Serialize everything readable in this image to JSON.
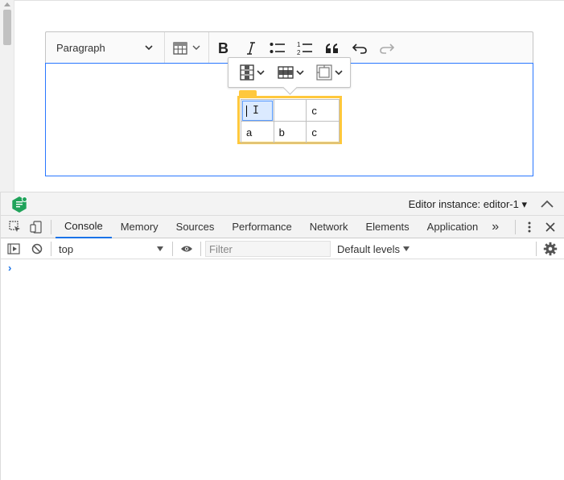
{
  "editor": {
    "heading_label": "Paragraph",
    "toolbar_icons": [
      "table-icon",
      "bold-icon",
      "italic-icon",
      "bulleted-list-icon",
      "numbered-list-icon",
      "quote-icon",
      "undo-icon",
      "redo-icon"
    ],
    "table": {
      "rows": [
        [
          "",
          "",
          "c"
        ],
        [
          "a",
          "b",
          "c"
        ]
      ]
    },
    "balloon_icons": [
      "table-column-icon",
      "table-row-icon",
      "merge-cells-icon"
    ]
  },
  "inspector": {
    "instance_label": "Editor instance: editor-1 ▾"
  },
  "devtools": {
    "tabs": [
      "Console",
      "Memory",
      "Sources",
      "Performance",
      "Network",
      "Elements",
      "Application"
    ],
    "more_tabs": "»",
    "context": "top",
    "filter_placeholder": "Filter",
    "levels_label": "Default levels",
    "prompt": "›"
  },
  "colors": {
    "focus_border": "#2977ff",
    "table_outline": "#ffc83d",
    "selected_cell": "#dbeaff",
    "active_tab_underline": "#1a73e8"
  }
}
